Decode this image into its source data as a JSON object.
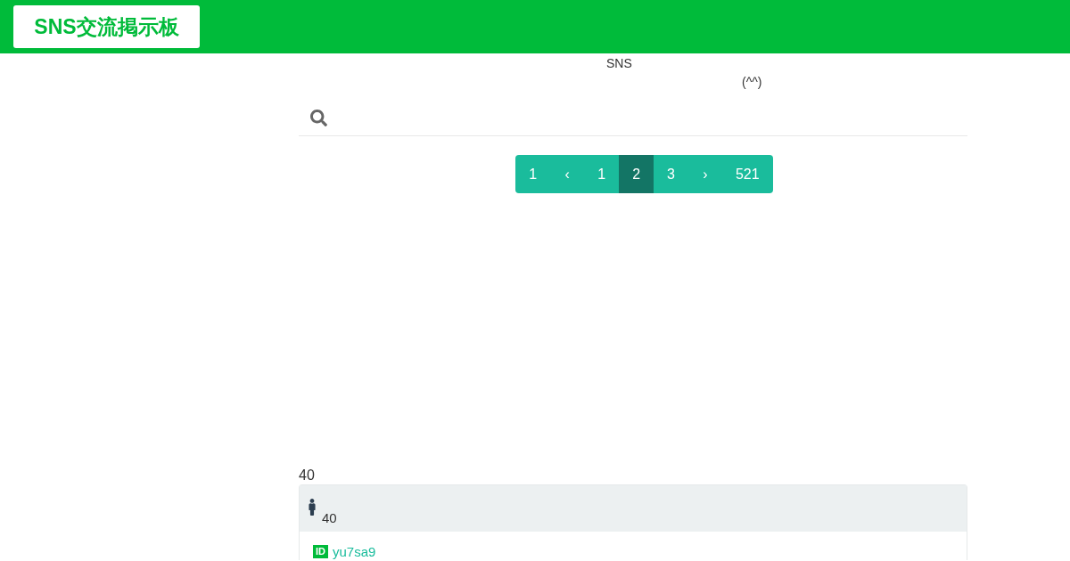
{
  "header": {
    "logo": "SNS交流掲示板"
  },
  "intro": {
    "line_1": "SNS",
    "line_2": "(^^)"
  },
  "pagination": [
    {
      "label": "1",
      "selected": false
    },
    {
      "label": "‹",
      "selected": false
    },
    {
      "label": "1",
      "selected": false
    },
    {
      "label": "2",
      "selected": true
    },
    {
      "label": "3",
      "selected": false
    },
    {
      "label": "›",
      "selected": false
    },
    {
      "label": "521",
      "selected": false
    }
  ],
  "count_label": "40",
  "card": {
    "header_count": "40",
    "user": {
      "badge": "ID",
      "name": "yu7sa9"
    }
  }
}
